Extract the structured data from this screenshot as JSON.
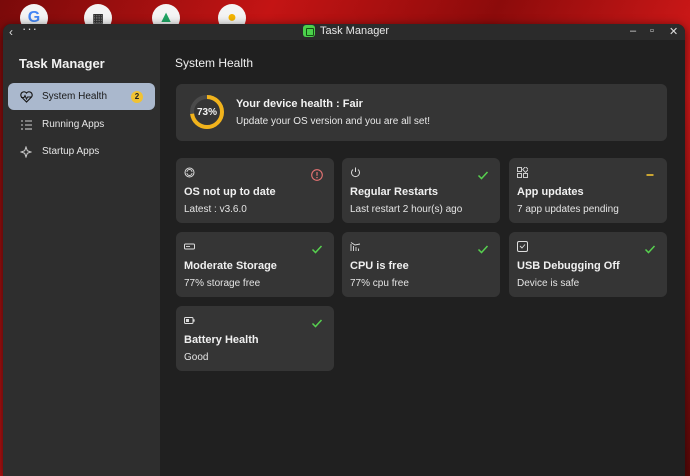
{
  "window": {
    "title": "Task Manager"
  },
  "sidebar": {
    "title": "Task Manager",
    "items": [
      {
        "label": "System Health",
        "badge": "2",
        "active": true
      },
      {
        "label": "Running Apps"
      },
      {
        "label": "Startup Apps"
      }
    ]
  },
  "main": {
    "title": "System Health",
    "health": {
      "percent_label": "73%",
      "percent": 73,
      "title": "Your device health : Fair",
      "subtitle": "Update your OS version and you are all set!"
    },
    "tiles": [
      {
        "title": "OS not up to date",
        "subtitle": "Latest : v3.6.0",
        "status": "warning"
      },
      {
        "title": "Regular Restarts",
        "subtitle": "Last restart 2 hour(s) ago",
        "status": "ok"
      },
      {
        "title": "App updates",
        "subtitle": "7 app updates pending",
        "status": "pending"
      },
      {
        "title": "Moderate Storage",
        "subtitle": "77% storage free",
        "status": "ok"
      },
      {
        "title": "CPU is free",
        "subtitle": "77% cpu free",
        "status": "ok"
      },
      {
        "title": "USB Debugging Off",
        "subtitle": "Device is safe",
        "status": "ok"
      },
      {
        "title": "Battery Health",
        "subtitle": "Good",
        "status": "ok"
      }
    ]
  },
  "colors": {
    "accent_ok": "#57d04f",
    "accent_warning": "#e57373",
    "accent_pending": "#f1c232",
    "ring": "#f1b31c",
    "sidebar_active": "#aab8cd"
  }
}
